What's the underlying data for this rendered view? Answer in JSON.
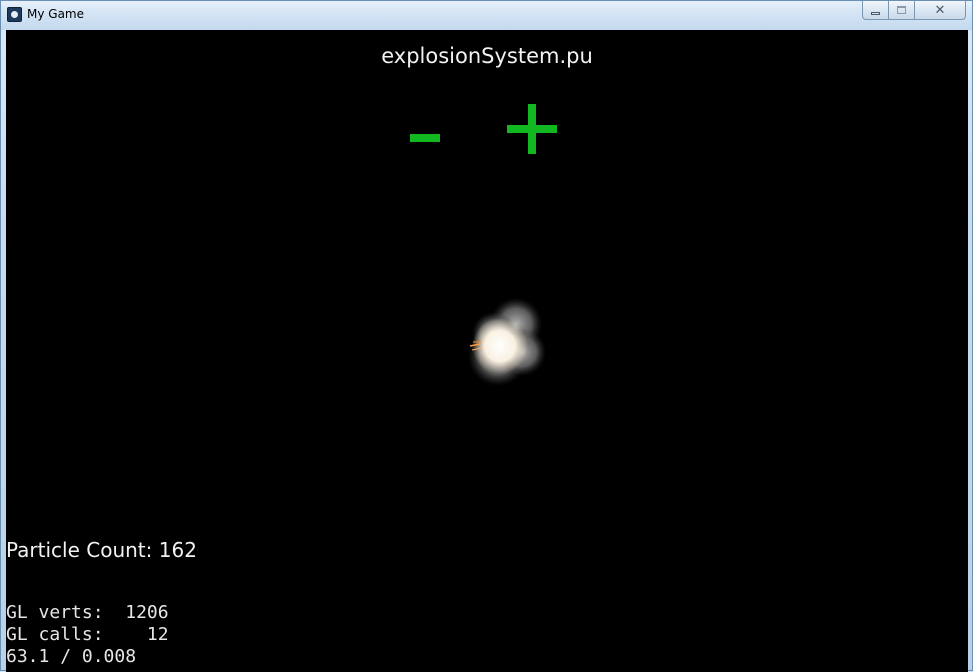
{
  "window": {
    "title": "My Game",
    "icon": "game-app-icon",
    "controls": {
      "minimize_icon": "minimize-icon",
      "maximize_icon": "maximize-icon",
      "close_icon": "close-icon",
      "close_glyph": "✕"
    }
  },
  "scene": {
    "title": "explosionSystem.pu",
    "decrease_label": "-",
    "increase_label": "+",
    "accent_color": "#12b81f",
    "effect": "explosion-particles"
  },
  "hud": {
    "particle_count_label": "Particle Count:",
    "particle_count_value": "162",
    "gl_verts_label": "GL verts:",
    "gl_verts_value": "1206",
    "gl_calls_label": "GL calls:",
    "gl_calls_value": "12",
    "fps": "63.1",
    "frame_time": "0.008"
  }
}
